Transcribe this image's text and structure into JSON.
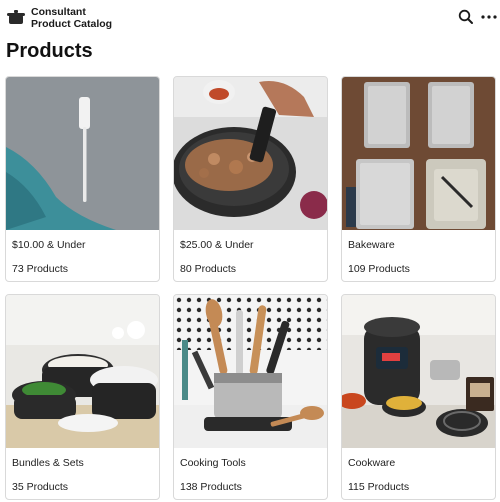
{
  "header": {
    "brand_line1": "Consultant",
    "brand_line2": "Product Catalog",
    "logo_icon": "cooking-pot-icon",
    "search_icon": "search-icon",
    "more_icon": "more-horizontal-icon"
  },
  "page": {
    "title": "Products"
  },
  "categories": [
    {
      "name": "$10.00 & Under",
      "count": "73 Products"
    },
    {
      "name": "$25.00 & Under",
      "count": "80 Products"
    },
    {
      "name": "Bakeware",
      "count": "109 Products"
    },
    {
      "name": "Bundles & Sets",
      "count": "35 Products"
    },
    {
      "name": "Cooking Tools",
      "count": "138 Products"
    },
    {
      "name": "Cookware",
      "count": "115 Products"
    }
  ]
}
